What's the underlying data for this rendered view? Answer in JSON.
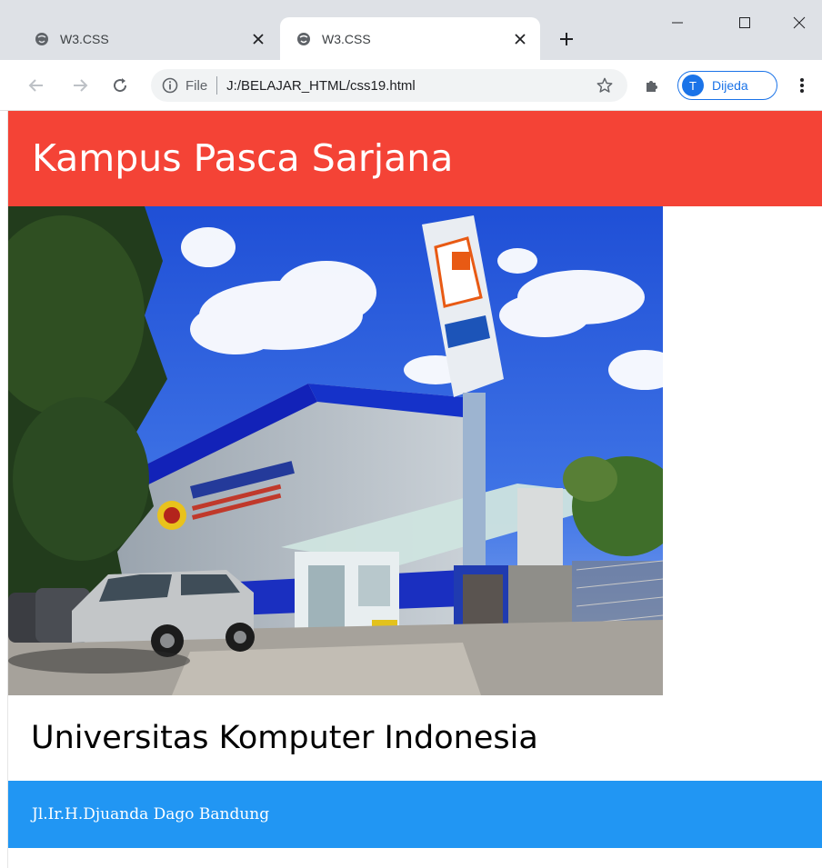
{
  "browser": {
    "tabs": [
      {
        "title": "W3.CSS",
        "active": false
      },
      {
        "title": "W3.CSS",
        "active": true
      }
    ],
    "address": {
      "scheme_label": "File",
      "url": "J:/BELAJAR_HTML/css19.html"
    },
    "profile": {
      "initial": "T",
      "name": "Dijeda"
    },
    "icons": {
      "tab_favicon": "globe-icon",
      "back": "back-arrow-icon",
      "forward": "forward-arrow-icon",
      "reload": "reload-icon",
      "info": "info-icon",
      "bookmark": "star-icon",
      "extensions": "puzzle-icon",
      "menu": "kebab-menu-icon"
    },
    "colors": {
      "tabbar": "#dee1e6",
      "accent": "#1a73e8"
    }
  },
  "page": {
    "header": {
      "title": "Kampus Pasca Sarjana",
      "color": "#f44336"
    },
    "image": {
      "subject": "campus-building-photo"
    },
    "subtitle": "Universitas Komputer Indonesia",
    "footer": {
      "text": "Jl.Ir.H.Djuanda Dago Bandung",
      "color": "#2196f3"
    }
  }
}
